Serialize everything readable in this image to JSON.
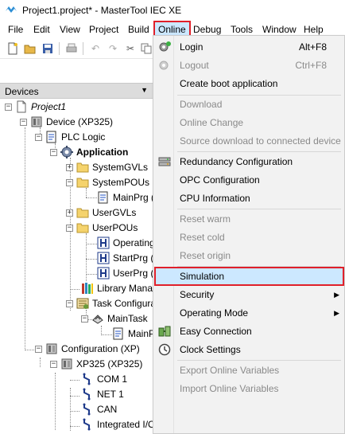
{
  "window": {
    "title": "Project1.project* - MasterTool IEC XE"
  },
  "menubar": {
    "items": [
      {
        "id": "file",
        "label": "File"
      },
      {
        "id": "edit",
        "label": "Edit"
      },
      {
        "id": "view",
        "label": "View"
      },
      {
        "id": "project",
        "label": "Project"
      },
      {
        "id": "build",
        "label": "Build"
      },
      {
        "id": "online",
        "label": "Online"
      },
      {
        "id": "debug",
        "label": "Debug"
      },
      {
        "id": "tools",
        "label": "Tools"
      },
      {
        "id": "window",
        "label": "Window"
      },
      {
        "id": "help",
        "label": "Help"
      }
    ],
    "highlight_color": "#e0202a"
  },
  "devices_panel": {
    "title": "Devices"
  },
  "tree": [
    {
      "label": "Project1",
      "icon": "project-icon"
    },
    {
      "label": "Device (XP325)",
      "icon": "device-icon"
    },
    {
      "label": "PLC Logic",
      "icon": "plc-logic-icon"
    },
    {
      "label": "Application",
      "icon": "application-gear-icon"
    },
    {
      "label": "SystemGVLs",
      "icon": "folder-icon"
    },
    {
      "label": "SystemPOUs",
      "icon": "folder-icon"
    },
    {
      "label": "MainPrg (P",
      "icon": "program-icon"
    },
    {
      "label": "UserGVLs",
      "icon": "folder-icon"
    },
    {
      "label": "UserPOUs",
      "icon": "folder-icon"
    },
    {
      "label": "Operating",
      "icon": "pou-icon"
    },
    {
      "label": "StartPrg (P",
      "icon": "pou-icon"
    },
    {
      "label": "UserPrg (P",
      "icon": "pou-icon"
    },
    {
      "label": "Library Manage",
      "icon": "library-icon"
    },
    {
      "label": "Task Configura",
      "icon": "task-config-icon"
    },
    {
      "label": "MainTask",
      "icon": "task-icon"
    },
    {
      "label": "MainPr",
      "icon": "program-icon"
    },
    {
      "label": "Configuration (XP)",
      "icon": "configuration-icon"
    },
    {
      "label": "XP325 (XP325)",
      "icon": "device-icon"
    },
    {
      "label": "COM 1",
      "icon": "connector-icon"
    },
    {
      "label": "NET 1",
      "icon": "connector-icon"
    },
    {
      "label": "CAN",
      "icon": "connector-icon"
    },
    {
      "label": "Integrated I/O",
      "icon": "connector-icon"
    }
  ],
  "online_menu": {
    "login": {
      "label": "Login",
      "shortcut": "Alt+F8"
    },
    "logout": {
      "label": "Logout",
      "shortcut": "Ctrl+F8"
    },
    "create_boot": {
      "label": "Create boot application"
    },
    "download": {
      "label": "Download"
    },
    "online_change": {
      "label": "Online Change"
    },
    "source_download": {
      "label": "Source download to connected device"
    },
    "redundancy": {
      "label": "Redundancy Configuration"
    },
    "opc": {
      "label": "OPC Configuration"
    },
    "cpu_info": {
      "label": "CPU Information"
    },
    "reset_warm": {
      "label": "Reset warm"
    },
    "reset_cold": {
      "label": "Reset cold"
    },
    "reset_origin": {
      "label": "Reset origin"
    },
    "simulation": {
      "label": "Simulation"
    },
    "security": {
      "label": "Security"
    },
    "operating_mode": {
      "label": "Operating Mode"
    },
    "easy_connection": {
      "label": "Easy Connection"
    },
    "clock_settings": {
      "label": "Clock Settings"
    },
    "export_vars": {
      "label": "Export Online Variables"
    },
    "import_vars": {
      "label": "Import Online Variables"
    }
  }
}
